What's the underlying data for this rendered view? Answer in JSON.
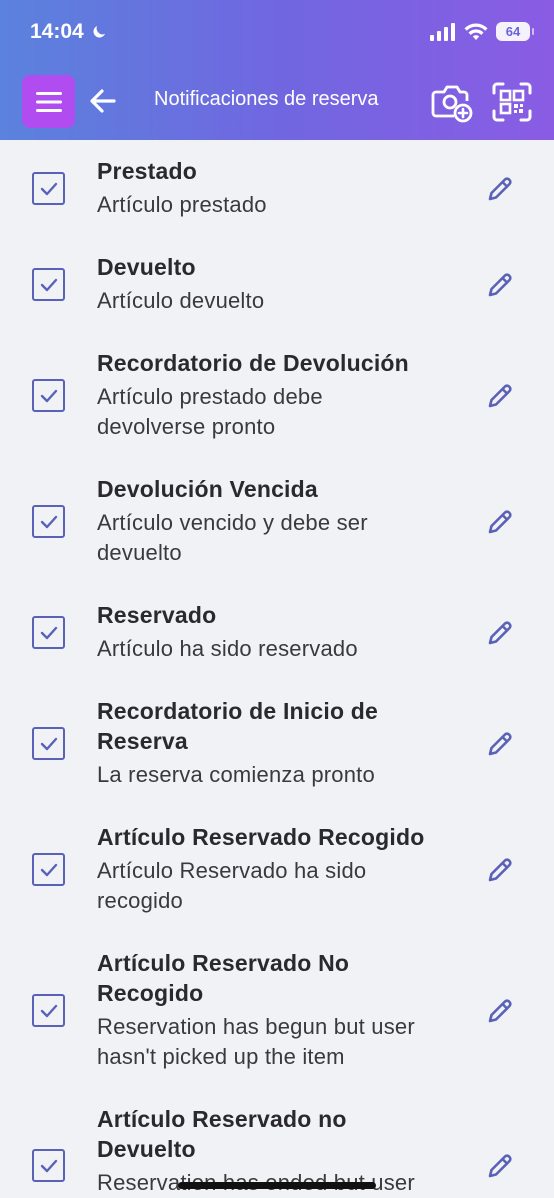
{
  "status_bar": {
    "time": "14:04",
    "battery": "64",
    "icons": [
      "moon-icon",
      "signal-icon",
      "wifi-icon",
      "battery-icon"
    ]
  },
  "toolbar": {
    "title": "Notificaciones de reserva",
    "icons": [
      "menu-icon",
      "back-arrow-icon",
      "camera-add-icon",
      "qr-scan-icon"
    ],
    "menu_color": "#b04cf0"
  },
  "colors": {
    "header_gradient_start": "#5b82dd",
    "header_gradient_end": "#8a5ce4",
    "accent": "#5a62b8",
    "background": "#f1f2f5"
  },
  "notifications": [
    {
      "title": "Prestado",
      "description": "Artículo prestado",
      "checked": true
    },
    {
      "title": "Devuelto",
      "description": "Artículo devuelto",
      "checked": true
    },
    {
      "title": "Recordatorio de Devolución",
      "description": "Artículo prestado debe devolverse pronto",
      "checked": true
    },
    {
      "title": "Devolución Vencida",
      "description": "Artículo vencido y debe ser devuelto",
      "checked": true
    },
    {
      "title": "Reservado",
      "description": "Artículo ha sido reservado",
      "checked": true
    },
    {
      "title": "Recordatorio de Inicio de Reserva",
      "description": "La reserva comienza pronto",
      "checked": true
    },
    {
      "title": "Artículo Reservado Recogido",
      "description": "Artículo Reservado ha sido recogido",
      "checked": true
    },
    {
      "title": "Artículo Reservado No Recogido",
      "description": "Reservation has begun but user hasn't picked up the item",
      "checked": true
    },
    {
      "title": "Artículo Reservado no Devuelto",
      "description": "Reservation has ended but user",
      "checked": true
    }
  ]
}
